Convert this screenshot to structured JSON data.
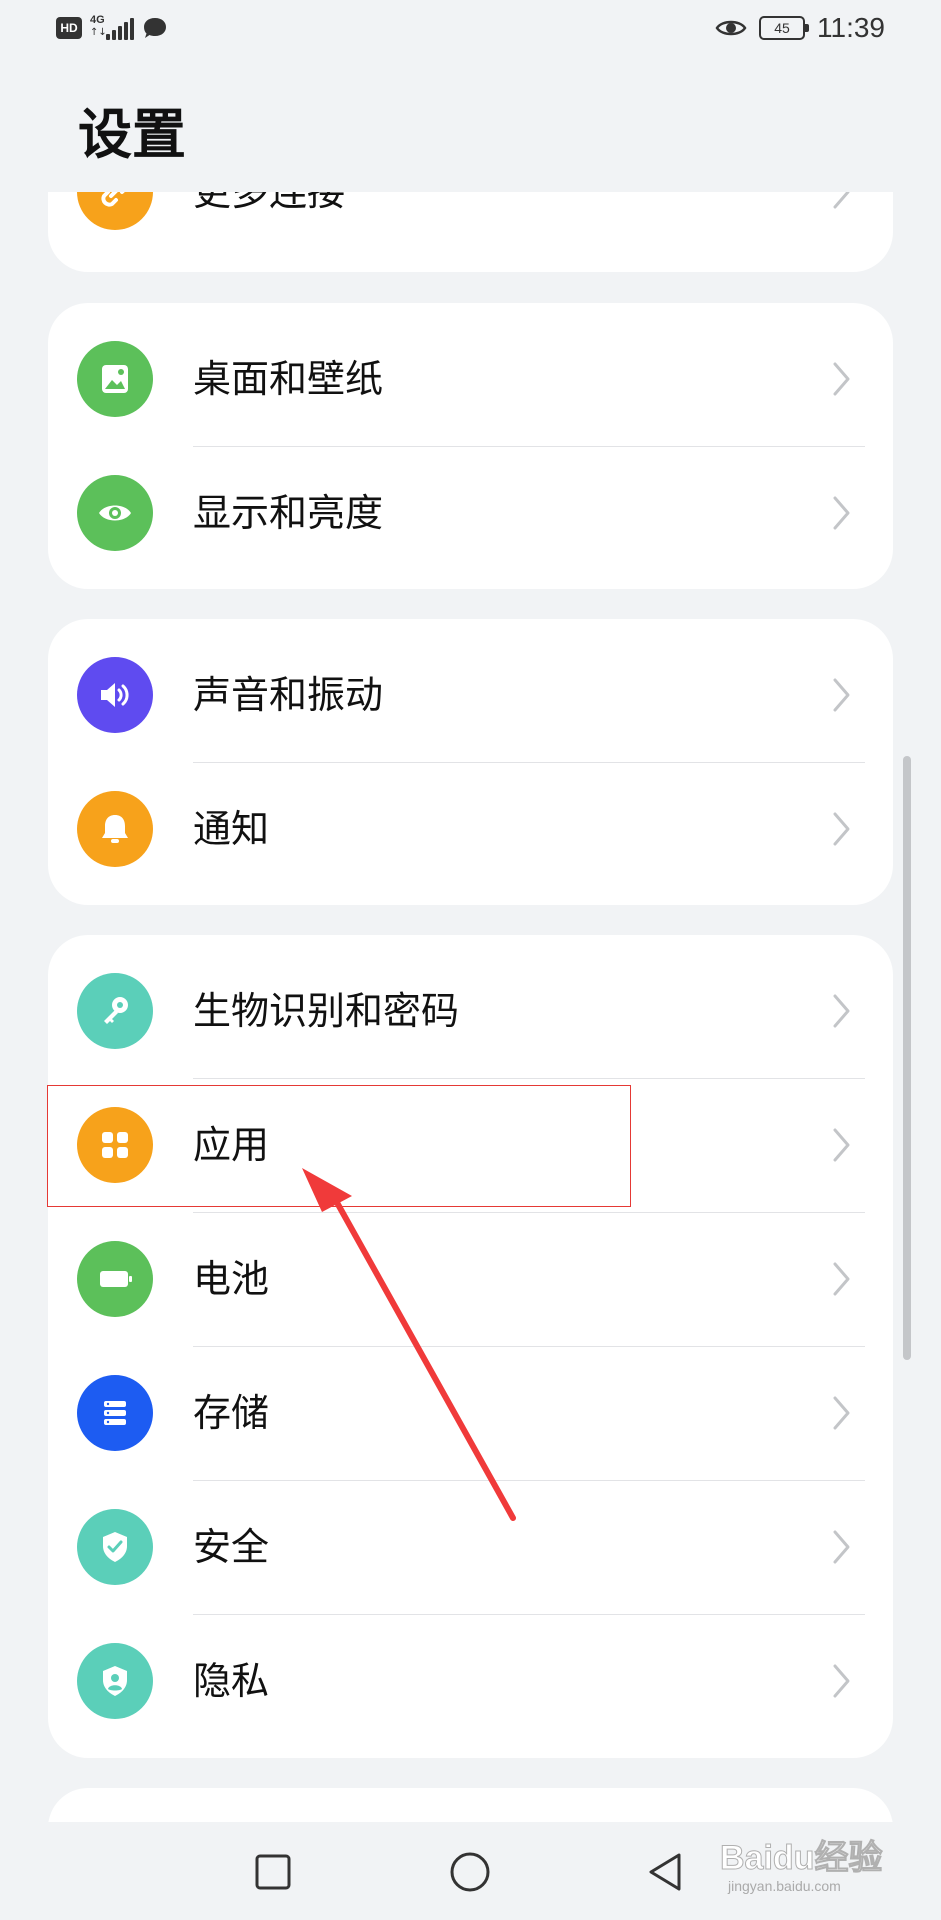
{
  "status_bar": {
    "hd_badge": "HD",
    "network_type": "4G",
    "network_activity": "↑↓",
    "battery_level": "45",
    "time": "11:39"
  },
  "page": {
    "title": "设置"
  },
  "groups": [
    {
      "items": [
        {
          "label": "更多连接",
          "icon": "link-icon",
          "color": "#f7a21b"
        }
      ]
    },
    {
      "items": [
        {
          "label": "桌面和壁纸",
          "icon": "wallpaper-icon",
          "color": "#5cc05a"
        },
        {
          "label": "显示和亮度",
          "icon": "eye-icon",
          "color": "#5cc05a"
        }
      ]
    },
    {
      "items": [
        {
          "label": "声音和振动",
          "icon": "speaker-icon",
          "color": "#5f4bf0"
        },
        {
          "label": "通知",
          "icon": "bell-icon",
          "color": "#f7a21b"
        }
      ]
    },
    {
      "items": [
        {
          "label": "生物识别和密码",
          "icon": "key-icon",
          "color": "#5bcfb9"
        },
        {
          "label": "应用",
          "icon": "apps-icon",
          "color": "#f7a21b"
        },
        {
          "label": "电池",
          "icon": "battery-icon",
          "color": "#5cc05a"
        },
        {
          "label": "存储",
          "icon": "storage-icon",
          "color": "#1d5cf2"
        },
        {
          "label": "安全",
          "icon": "shield-icon",
          "color": "#5bcfb9"
        },
        {
          "label": "隐私",
          "icon": "privacy-icon",
          "color": "#5bcfb9"
        }
      ]
    }
  ],
  "annotation": {
    "highlighted_item": "应用",
    "highlight_color": "#e53935"
  },
  "nav_bar": {
    "buttons": [
      "recent-apps-icon",
      "home-icon",
      "back-icon"
    ]
  },
  "watermark": {
    "main": "Baidu经验",
    "sub": "jingyan.baidu.com"
  }
}
